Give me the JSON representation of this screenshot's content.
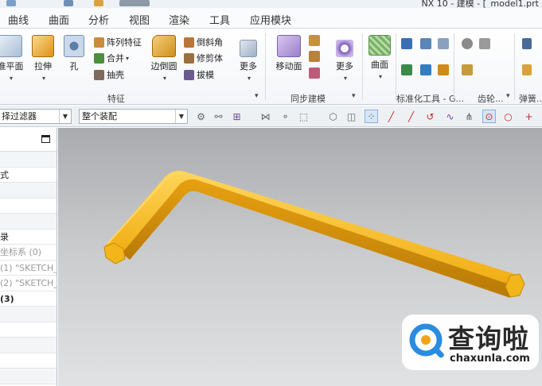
{
  "window": {
    "title": "NX 10 - 建模 - [_model1.prt"
  },
  "menu": {
    "items": [
      "曲线",
      "曲面",
      "分析",
      "视图",
      "渲染",
      "工具",
      "应用模块"
    ]
  },
  "ribbon": {
    "groups": {
      "feature": {
        "label": "特征",
        "big": {
          "datum_plane": "准平面",
          "extrude": "拉伸",
          "hole": "孔",
          "edge_blend": "边倒圆",
          "more": "更多"
        },
        "small": {
          "pattern_feature": "阵列特征",
          "unite": "合并",
          "shell": "抽壳",
          "chamfer": "倒斜角",
          "trim_body": "修剪体",
          "draft": "拔模"
        }
      },
      "sync": {
        "label": "同步建模",
        "big": {
          "move_face": "移动面",
          "more": "更多"
        }
      },
      "surface": {
        "big": {
          "surface": "曲面"
        }
      },
      "standard_tools": {
        "label": "标准化工具 - G..."
      },
      "gear": {
        "label": "齿轮..."
      },
      "spring": {
        "label": "弹簧..."
      }
    }
  },
  "filterbar": {
    "selection_filter": "择过滤器",
    "assembly_scope": "整个装配"
  },
  "navigator": {
    "rows": [
      {
        "text": "",
        "style": "alt"
      },
      {
        "text": "式",
        "style": ""
      },
      {
        "text": "",
        "style": "alt"
      },
      {
        "text": "",
        "style": ""
      },
      {
        "text": "",
        "style": "alt"
      },
      {
        "text": "录",
        "style": ""
      },
      {
        "text": "坐标系 (0)",
        "style": "dim"
      },
      {
        "text": "(1) \"SKETCH_",
        "style": "dim"
      },
      {
        "text": "(2) \"SKETCH_",
        "style": "dim"
      },
      {
        "text": "(3)",
        "style": "bold"
      },
      {
        "text": "",
        "style": "alt"
      },
      {
        "text": "",
        "style": ""
      },
      {
        "text": "",
        "style": "alt"
      },
      {
        "text": "",
        "style": ""
      },
      {
        "text": "",
        "style": "alt"
      },
      {
        "text": "",
        "style": ""
      }
    ]
  },
  "model": {
    "color": "#f2b61a",
    "shade_color": "#c98a08",
    "highlight_color": "#ffd868"
  },
  "watermark": {
    "title": "查询啦",
    "url": "chaxunla.com",
    "accent": "#2a8be0"
  }
}
